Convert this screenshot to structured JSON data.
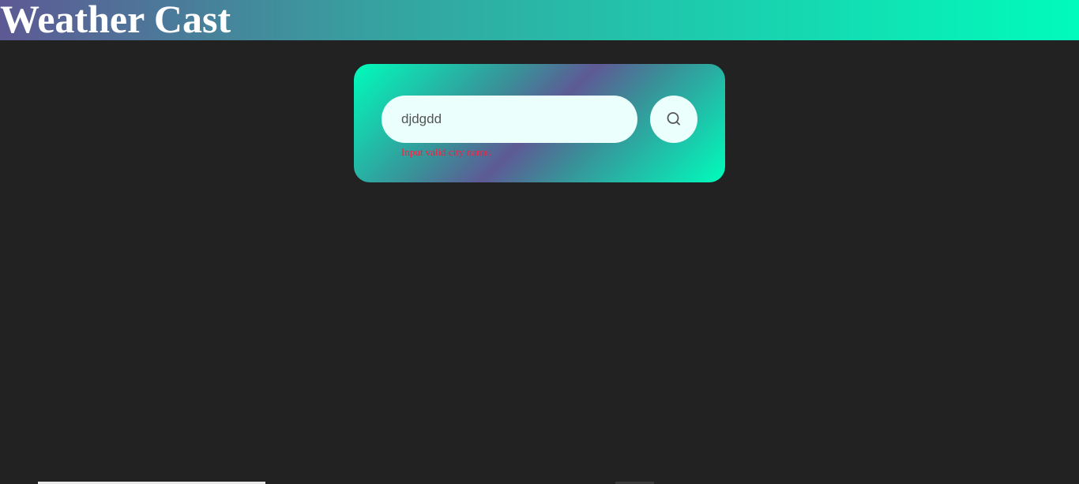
{
  "header": {
    "title": "Weather Cast"
  },
  "search": {
    "value": "djdgdd",
    "button_icon": "search-icon",
    "error": "Input valid city name."
  },
  "colors": {
    "background": "#222222",
    "accent_teal": "#00fcbc",
    "accent_purple": "#5e5a95",
    "input_bg": "#ebfffc",
    "error": "#ff1a3c"
  }
}
